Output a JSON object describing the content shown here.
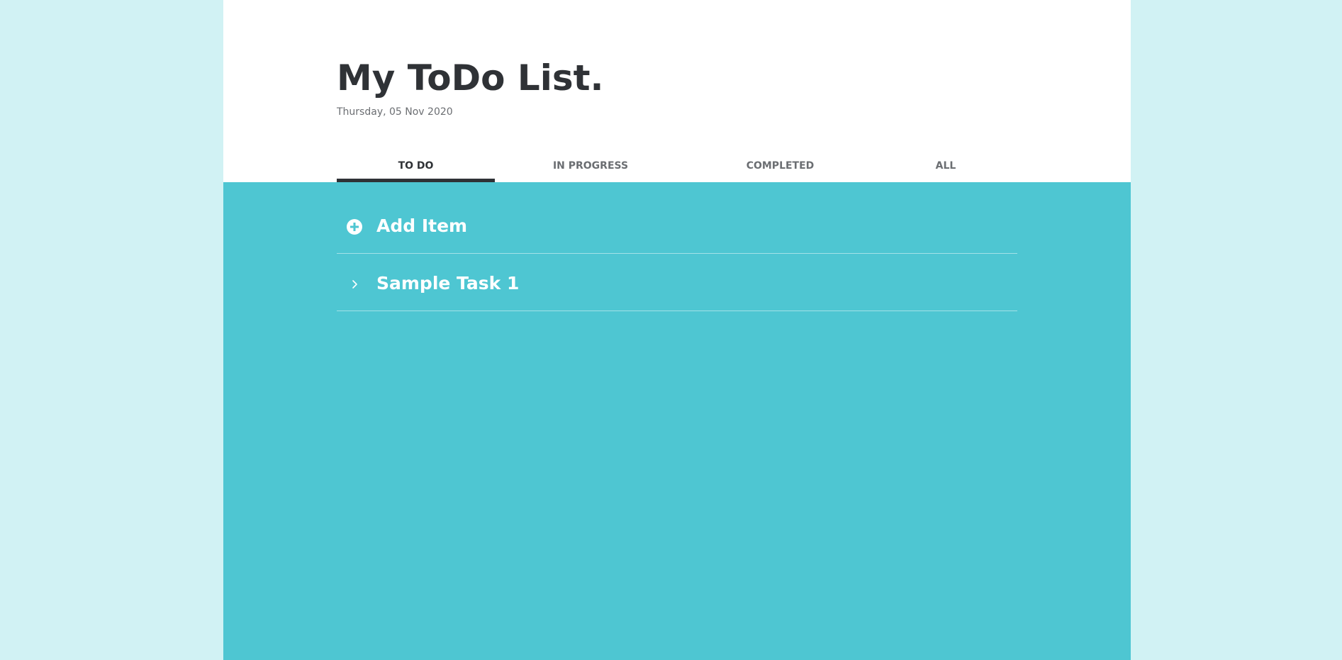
{
  "header": {
    "title": "My ToDo List.",
    "date": "Thursday, 05 Nov 2020"
  },
  "tabs": [
    {
      "label": "TO DO",
      "active": true
    },
    {
      "label": "IN PROGRESS",
      "active": false
    },
    {
      "label": "COMPLETED",
      "active": false
    },
    {
      "label": "ALL",
      "active": false
    }
  ],
  "list": {
    "add_label": "Add Item",
    "add_icon": "plus-circle-icon",
    "items": [
      {
        "label": "Sample Task 1",
        "icon": "chevron-right-icon"
      }
    ]
  },
  "colors": {
    "page_background": "#d1f2f4",
    "panel_background": "#4ec6d2",
    "header_background": "#ffffff",
    "text_dark": "#2f3236",
    "text_muted": "#6b6e72",
    "divider": "#a3e1e7"
  }
}
